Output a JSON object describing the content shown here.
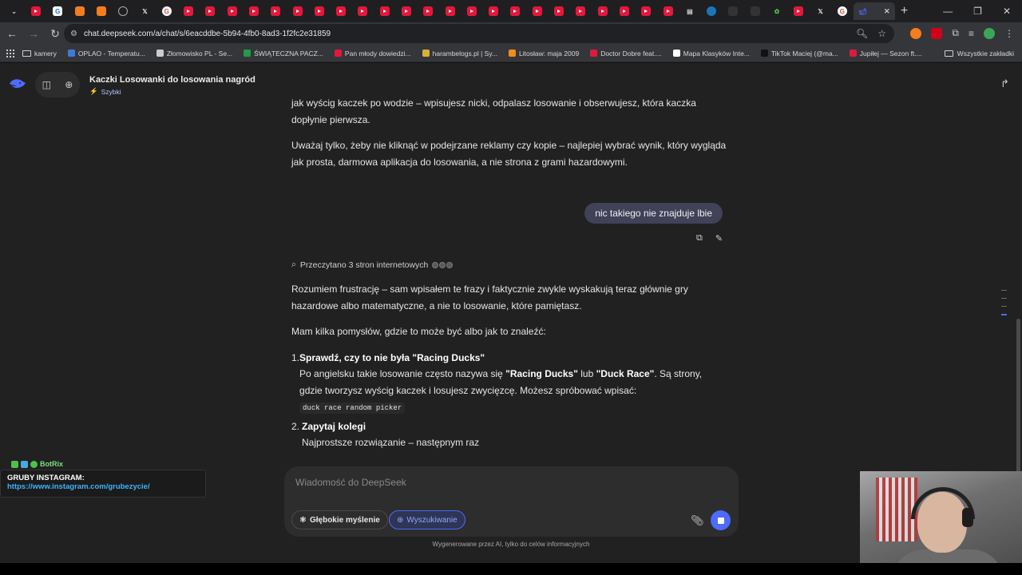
{
  "browser": {
    "tab_count_visible": 40,
    "url": "chat.deepseek.com/a/chat/s/6eacddbe-5b94-4fb0-8ad3-1f2fc2e31859",
    "new_tab_symbol": "+",
    "bookmarks": [
      {
        "label": "kamery",
        "type": "folder"
      },
      {
        "label": "OPLAO - Temperatu...",
        "color": "#3d7bd9"
      },
      {
        "label": "Złomowisko PL - Se...",
        "color": "#cccccc"
      },
      {
        "label": "ŚWIĄTECZNA PACZ...",
        "color": "#1e9e4a"
      },
      {
        "label": "Pan młody dowiedzi...",
        "color": "#e4173b"
      },
      {
        "label": "harambelogs.pl | Sy...",
        "color": "#d8b13a"
      },
      {
        "label": "Litosław: maja 2009",
        "color": "#f28c1c"
      },
      {
        "label": "Doctor Dobre feat....",
        "color": "#e4173b"
      },
      {
        "label": "Mapa Klasyków Inte...",
        "color": "#ffffff"
      },
      {
        "label": "TikTok Maciej (@ma...",
        "color": "#111111"
      },
      {
        "label": "Jupiłej — Sezon ft....",
        "color": "#e4173b"
      }
    ],
    "all_bookmarks_label": "Wszystkie zakładki"
  },
  "sidebar": {
    "chat_title": "Kaczki Losowanki do losowania nagród",
    "mode_label": "Szybki"
  },
  "conversation": {
    "prev_p1": "jak wyścig kaczek po wodzie – wpisujesz nicki, odpalasz losowanie i obserwujesz, która kaczka dopłynie pierwsza.",
    "prev_p2": "Uważaj tylko, żeby nie kliknąć w podejrzane reklamy czy kopie – najlepiej wybrać wynik, który wygląda jak prosta, darmowa aplikacja do losowania, a nie strona z grami hazardowymi.",
    "user_message": "nic takiego nie znajduje lbie",
    "search_status": "Przeczytano 3 stron internetowych",
    "answer_p1": "Rozumiem frustrację – sam wpisałem te frazy i faktycznie zwykle wyskakują teraz głównie gry hazardowe albo matematyczne, a nie to losowanie, które pamiętasz.",
    "answer_p2": "Mam kilka pomysłów, gdzie to może być albo jak to znaleźć:",
    "list": [
      {
        "num": "1.",
        "title": "Sprawdź, czy to nie była \"Racing Ducks\"",
        "body_a": "Po angielsku takie losowanie często nazywa się ",
        "bold_a": "\"Racing Ducks\"",
        "body_b": " lub ",
        "bold_b": "\"Duck Race\"",
        "body_c": ". Są strony, gdzie tworzysz wyścig kaczek i losujesz zwycięzcę. Możesz spróbować wpisać:",
        "code": "duck race random picker"
      },
      {
        "num": "2.",
        "title": "Zapytaj kolegi",
        "body": "Najprostsze rozwiązanie – następnym raz"
      }
    ]
  },
  "composer": {
    "placeholder": "Wiadomość do DeepSeek",
    "deep_think_label": "Głębokie myślenie",
    "search_label": "Wyszukiwanie"
  },
  "disclaimer": "Wygenerowane przez AI, tylko do celów informacyjnych",
  "stream_overlay": {
    "bot_name": "BotRix",
    "insta_title": "GRUBY INSTAGRAM:",
    "insta_url": "https://www.instagram.com/grubezycie/"
  },
  "colors": {
    "accent": "#4d6bfe",
    "background": "#212121",
    "user_bubble": "#414158"
  }
}
